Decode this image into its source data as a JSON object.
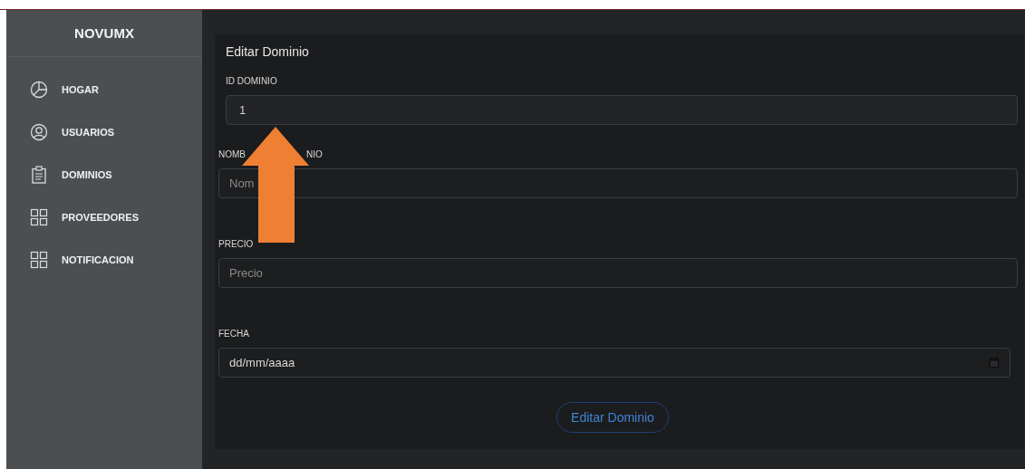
{
  "sidebar": {
    "title": "NOVUMX",
    "items": [
      {
        "label": "HOGAR"
      },
      {
        "label": "USUARIOS"
      },
      {
        "label": "DOMINIOS"
      },
      {
        "label": "PROVEEDORES"
      },
      {
        "label": "NOTIFICACION"
      }
    ]
  },
  "form": {
    "title": "Editar Dominio",
    "fields": [
      {
        "kind": "filled",
        "label": [
          "ID DOMINIO"
        ],
        "value": "1"
      },
      {
        "kind": "text",
        "label": [
          "NOMB",
          "NIO"
        ],
        "placeholder": "Nom"
      },
      {
        "kind": "text",
        "label": [
          "PRECIO"
        ],
        "placeholder": "Precio"
      },
      {
        "kind": "date",
        "label": [
          "FECHA"
        ],
        "value": "dd/mm/aaaa"
      }
    ],
    "submit": "Editar Dominio"
  },
  "overlay": {
    "kind": "up-arrow"
  }
}
